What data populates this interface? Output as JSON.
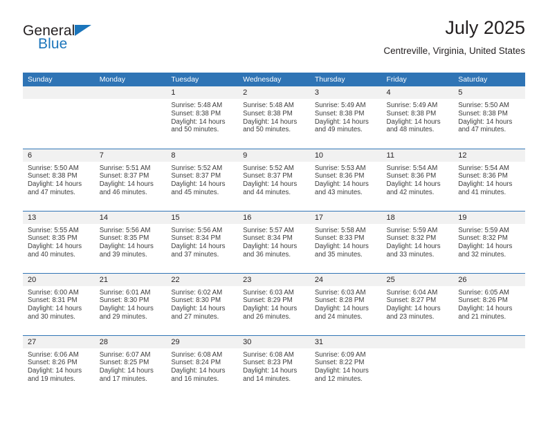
{
  "brand": {
    "general": "General",
    "blue": "Blue",
    "triangle_color": "#1b75bb"
  },
  "header": {
    "title": "July 2025",
    "location": "Centreville, Virginia, United States"
  },
  "colors": {
    "header_bar": "#2f74b5",
    "daynum_band": "#f1f1f1",
    "text": "#231f20",
    "body_text": "#3c3c3c"
  },
  "weekday_headers": [
    "Sunday",
    "Monday",
    "Tuesday",
    "Wednesday",
    "Thursday",
    "Friday",
    "Saturday"
  ],
  "weeks": [
    [
      {
        "day": "",
        "sunrise": "",
        "sunset": "",
        "daylight_1": "",
        "daylight_2": ""
      },
      {
        "day": "",
        "sunrise": "",
        "sunset": "",
        "daylight_1": "",
        "daylight_2": ""
      },
      {
        "day": "1",
        "sunrise": "Sunrise: 5:48 AM",
        "sunset": "Sunset: 8:38 PM",
        "daylight_1": "Daylight: 14 hours",
        "daylight_2": "and 50 minutes."
      },
      {
        "day": "2",
        "sunrise": "Sunrise: 5:48 AM",
        "sunset": "Sunset: 8:38 PM",
        "daylight_1": "Daylight: 14 hours",
        "daylight_2": "and 50 minutes."
      },
      {
        "day": "3",
        "sunrise": "Sunrise: 5:49 AM",
        "sunset": "Sunset: 8:38 PM",
        "daylight_1": "Daylight: 14 hours",
        "daylight_2": "and 49 minutes."
      },
      {
        "day": "4",
        "sunrise": "Sunrise: 5:49 AM",
        "sunset": "Sunset: 8:38 PM",
        "daylight_1": "Daylight: 14 hours",
        "daylight_2": "and 48 minutes."
      },
      {
        "day": "5",
        "sunrise": "Sunrise: 5:50 AM",
        "sunset": "Sunset: 8:38 PM",
        "daylight_1": "Daylight: 14 hours",
        "daylight_2": "and 47 minutes."
      }
    ],
    [
      {
        "day": "6",
        "sunrise": "Sunrise: 5:50 AM",
        "sunset": "Sunset: 8:38 PM",
        "daylight_1": "Daylight: 14 hours",
        "daylight_2": "and 47 minutes."
      },
      {
        "day": "7",
        "sunrise": "Sunrise: 5:51 AM",
        "sunset": "Sunset: 8:37 PM",
        "daylight_1": "Daylight: 14 hours",
        "daylight_2": "and 46 minutes."
      },
      {
        "day": "8",
        "sunrise": "Sunrise: 5:52 AM",
        "sunset": "Sunset: 8:37 PM",
        "daylight_1": "Daylight: 14 hours",
        "daylight_2": "and 45 minutes."
      },
      {
        "day": "9",
        "sunrise": "Sunrise: 5:52 AM",
        "sunset": "Sunset: 8:37 PM",
        "daylight_1": "Daylight: 14 hours",
        "daylight_2": "and 44 minutes."
      },
      {
        "day": "10",
        "sunrise": "Sunrise: 5:53 AM",
        "sunset": "Sunset: 8:36 PM",
        "daylight_1": "Daylight: 14 hours",
        "daylight_2": "and 43 minutes."
      },
      {
        "day": "11",
        "sunrise": "Sunrise: 5:54 AM",
        "sunset": "Sunset: 8:36 PM",
        "daylight_1": "Daylight: 14 hours",
        "daylight_2": "and 42 minutes."
      },
      {
        "day": "12",
        "sunrise": "Sunrise: 5:54 AM",
        "sunset": "Sunset: 8:36 PM",
        "daylight_1": "Daylight: 14 hours",
        "daylight_2": "and 41 minutes."
      }
    ],
    [
      {
        "day": "13",
        "sunrise": "Sunrise: 5:55 AM",
        "sunset": "Sunset: 8:35 PM",
        "daylight_1": "Daylight: 14 hours",
        "daylight_2": "and 40 minutes."
      },
      {
        "day": "14",
        "sunrise": "Sunrise: 5:56 AM",
        "sunset": "Sunset: 8:35 PM",
        "daylight_1": "Daylight: 14 hours",
        "daylight_2": "and 39 minutes."
      },
      {
        "day": "15",
        "sunrise": "Sunrise: 5:56 AM",
        "sunset": "Sunset: 8:34 PM",
        "daylight_1": "Daylight: 14 hours",
        "daylight_2": "and 37 minutes."
      },
      {
        "day": "16",
        "sunrise": "Sunrise: 5:57 AM",
        "sunset": "Sunset: 8:34 PM",
        "daylight_1": "Daylight: 14 hours",
        "daylight_2": "and 36 minutes."
      },
      {
        "day": "17",
        "sunrise": "Sunrise: 5:58 AM",
        "sunset": "Sunset: 8:33 PM",
        "daylight_1": "Daylight: 14 hours",
        "daylight_2": "and 35 minutes."
      },
      {
        "day": "18",
        "sunrise": "Sunrise: 5:59 AM",
        "sunset": "Sunset: 8:32 PM",
        "daylight_1": "Daylight: 14 hours",
        "daylight_2": "and 33 minutes."
      },
      {
        "day": "19",
        "sunrise": "Sunrise: 5:59 AM",
        "sunset": "Sunset: 8:32 PM",
        "daylight_1": "Daylight: 14 hours",
        "daylight_2": "and 32 minutes."
      }
    ],
    [
      {
        "day": "20",
        "sunrise": "Sunrise: 6:00 AM",
        "sunset": "Sunset: 8:31 PM",
        "daylight_1": "Daylight: 14 hours",
        "daylight_2": "and 30 minutes."
      },
      {
        "day": "21",
        "sunrise": "Sunrise: 6:01 AM",
        "sunset": "Sunset: 8:30 PM",
        "daylight_1": "Daylight: 14 hours",
        "daylight_2": "and 29 minutes."
      },
      {
        "day": "22",
        "sunrise": "Sunrise: 6:02 AM",
        "sunset": "Sunset: 8:30 PM",
        "daylight_1": "Daylight: 14 hours",
        "daylight_2": "and 27 minutes."
      },
      {
        "day": "23",
        "sunrise": "Sunrise: 6:03 AM",
        "sunset": "Sunset: 8:29 PM",
        "daylight_1": "Daylight: 14 hours",
        "daylight_2": "and 26 minutes."
      },
      {
        "day": "24",
        "sunrise": "Sunrise: 6:03 AM",
        "sunset": "Sunset: 8:28 PM",
        "daylight_1": "Daylight: 14 hours",
        "daylight_2": "and 24 minutes."
      },
      {
        "day": "25",
        "sunrise": "Sunrise: 6:04 AM",
        "sunset": "Sunset: 8:27 PM",
        "daylight_1": "Daylight: 14 hours",
        "daylight_2": "and 23 minutes."
      },
      {
        "day": "26",
        "sunrise": "Sunrise: 6:05 AM",
        "sunset": "Sunset: 8:26 PM",
        "daylight_1": "Daylight: 14 hours",
        "daylight_2": "and 21 minutes."
      }
    ],
    [
      {
        "day": "27",
        "sunrise": "Sunrise: 6:06 AM",
        "sunset": "Sunset: 8:26 PM",
        "daylight_1": "Daylight: 14 hours",
        "daylight_2": "and 19 minutes."
      },
      {
        "day": "28",
        "sunrise": "Sunrise: 6:07 AM",
        "sunset": "Sunset: 8:25 PM",
        "daylight_1": "Daylight: 14 hours",
        "daylight_2": "and 17 minutes."
      },
      {
        "day": "29",
        "sunrise": "Sunrise: 6:08 AM",
        "sunset": "Sunset: 8:24 PM",
        "daylight_1": "Daylight: 14 hours",
        "daylight_2": "and 16 minutes."
      },
      {
        "day": "30",
        "sunrise": "Sunrise: 6:08 AM",
        "sunset": "Sunset: 8:23 PM",
        "daylight_1": "Daylight: 14 hours",
        "daylight_2": "and 14 minutes."
      },
      {
        "day": "31",
        "sunrise": "Sunrise: 6:09 AM",
        "sunset": "Sunset: 8:22 PM",
        "daylight_1": "Daylight: 14 hours",
        "daylight_2": "and 12 minutes."
      },
      {
        "day": "",
        "sunrise": "",
        "sunset": "",
        "daylight_1": "",
        "daylight_2": ""
      },
      {
        "day": "",
        "sunrise": "",
        "sunset": "",
        "daylight_1": "",
        "daylight_2": ""
      }
    ]
  ]
}
